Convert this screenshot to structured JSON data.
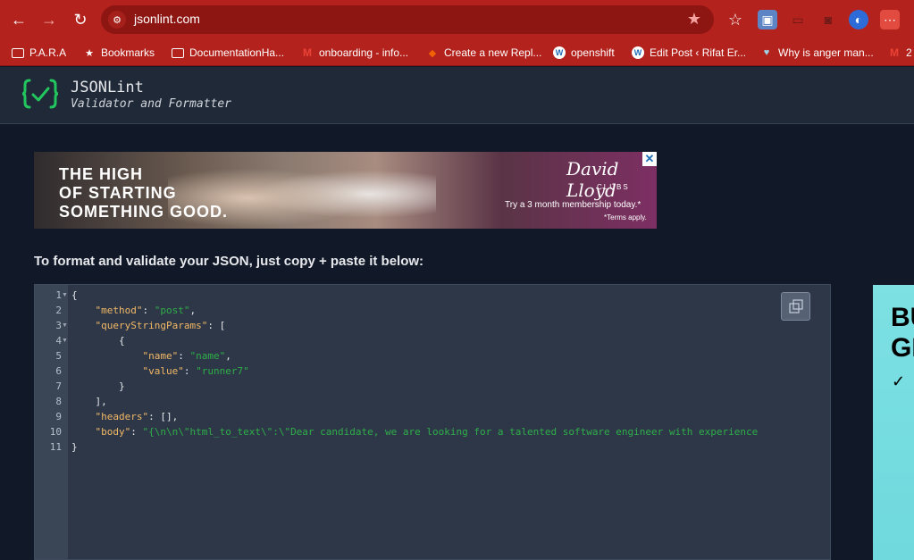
{
  "browser": {
    "url": "jsonlint.com",
    "bookmarks": [
      {
        "label": "P.A.R.A",
        "icon": "folder-icon"
      },
      {
        "label": "Bookmarks",
        "icon": "star-icon"
      },
      {
        "label": "DocumentationHa...",
        "icon": "folder-icon"
      },
      {
        "label": "onboarding - info...",
        "icon": "gmail-icon"
      },
      {
        "label": "Create a new Repl...",
        "icon": "replit-icon"
      },
      {
        "label": "openshift",
        "icon": "wordpress-icon"
      },
      {
        "label": "Edit Post ‹ Rifat Er...",
        "icon": "wordpress-icon"
      },
      {
        "label": "Why is anger man...",
        "icon": "heart-icon"
      },
      {
        "label": "2",
        "icon": "gmail-icon"
      }
    ]
  },
  "site": {
    "title": "JSONLint",
    "subtitle": "Validator and Formatter",
    "accent": "#22c55e"
  },
  "ad": {
    "headline": [
      "THE HIGH",
      "OF STARTING",
      "SOMETHING GOOD."
    ],
    "brand": "David Lloyd",
    "brand_sub": "CLUBS",
    "cta": "Try a 3 month membership today.*",
    "terms": "*Terms apply."
  },
  "main": {
    "intro": "To format and validate your JSON, just copy + paste it below:"
  },
  "editor": {
    "lines": [
      {
        "n": "1",
        "fold": true
      },
      {
        "n": "2",
        "fold": false
      },
      {
        "n": "3",
        "fold": true
      },
      {
        "n": "4",
        "fold": true
      },
      {
        "n": "5",
        "fold": false
      },
      {
        "n": "6",
        "fold": false
      },
      {
        "n": "7",
        "fold": false
      },
      {
        "n": "8",
        "fold": false
      },
      {
        "n": "9",
        "fold": false
      },
      {
        "n": "10",
        "fold": false
      },
      {
        "n": "11",
        "fold": false
      }
    ],
    "tokens": {
      "open_brace": "{",
      "k_method": "\"method\"",
      "v_method": "\"post\"",
      "k_qsp": "\"queryStringParams\"",
      "open_bracket": ": [",
      "inner_open": "{",
      "k_name": "\"name\"",
      "v_name": "\"name\"",
      "k_value": "\"value\"",
      "v_value": "\"runner7\"",
      "inner_close": "}",
      "close_bracket": "],",
      "k_headers": "\"headers\"",
      "v_headers": ": [],",
      "k_body": "\"body\"",
      "v_body": "\"{\\n\\n\\\"html_to_text\\\":\\\"Dear candidate, we are looking for a talented software engineer with experience",
      "close_brace": "}"
    }
  },
  "side_ad": {
    "text": [
      "BU",
      "GI"
    ]
  }
}
